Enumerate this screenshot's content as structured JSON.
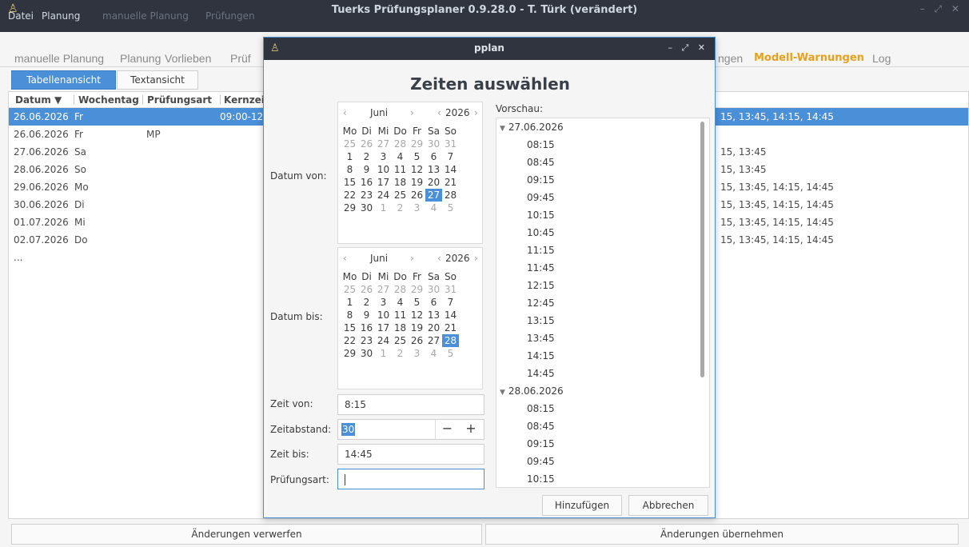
{
  "window": {
    "title": "Tuerks Prüfungsplaner 0.9.28.0 - T. Türk (verändert)",
    "controls": "– ⤢ ✕"
  },
  "menubar": {
    "items": [
      "Datei",
      "Planung",
      "manuelle Planung",
      "Prüfungen"
    ]
  },
  "navtabs": {
    "items": [
      "manuelle Planung",
      "Planung",
      "Vorlieben",
      "Prüf"
    ],
    "right_partial": "ngen",
    "warnings": "Modell-Warnungen",
    "log": "Log"
  },
  "viewtabs": {
    "table": "Tabellenansicht",
    "text": "Textansicht"
  },
  "table": {
    "headers": {
      "datum": "Datum ▼",
      "wochentag": "Wochentag",
      "pruefungsart": "Prüfungsart",
      "kernzeit": "Kernzei"
    },
    "rows": [
      {
        "datum": "26.06.2026",
        "tag": "Fr",
        "art": "",
        "kern": "09:00-12",
        "times": "15, 13:45, 14:15, 14:45"
      },
      {
        "datum": "26.06.2026",
        "tag": "Fr",
        "art": "MP",
        "kern": "",
        "times": ""
      },
      {
        "datum": "27.06.2026",
        "tag": "Sa",
        "art": "",
        "kern": "",
        "times": "15, 13:45"
      },
      {
        "datum": "28.06.2026",
        "tag": "So",
        "art": "",
        "kern": "",
        "times": "15, 13:45"
      },
      {
        "datum": "29.06.2026",
        "tag": "Mo",
        "art": "",
        "kern": "",
        "times": "15, 13:45, 14:15, 14:45"
      },
      {
        "datum": "30.06.2026",
        "tag": "Di",
        "art": "",
        "kern": "",
        "times": "15, 13:45, 14:15, 14:45"
      },
      {
        "datum": "01.07.2026",
        "tag": "Mi",
        "art": "",
        "kern": "",
        "times": "15, 13:45, 14:15, 14:45"
      },
      {
        "datum": "02.07.2026",
        "tag": "Do",
        "art": "",
        "kern": "",
        "times": "15, 13:45, 14:15, 14:45"
      }
    ],
    "ellipsis": "..."
  },
  "bottom": {
    "discard": "Änderungen verwerfen",
    "apply": "Änderungen übernehmen"
  },
  "dialog": {
    "title": "pplan",
    "controls": "– ⤢ ✕",
    "heading": "Zeiten auswählen",
    "labels": {
      "datum_von": "Datum von:",
      "datum_bis": "Datum bis:",
      "zeit_von": "Zeit von:",
      "zeitabstand": "Zeitabstand:",
      "zeit_bis": "Zeit bis:",
      "pruefungsart": "Prüfungsart:",
      "vorschau": "Vorschau:"
    },
    "calendar": {
      "month": "Juni",
      "year": "2026",
      "weekdays": [
        "Mo",
        "Di",
        "Mi",
        "Do",
        "Fr",
        "Sa",
        "So"
      ],
      "weeks": [
        [
          "25",
          "26",
          "27",
          "28",
          "29",
          "30",
          "31"
        ],
        [
          "1",
          "2",
          "3",
          "4",
          "5",
          "6",
          "7"
        ],
        [
          "8",
          "9",
          "10",
          "11",
          "12",
          "13",
          "14"
        ],
        [
          "15",
          "16",
          "17",
          "18",
          "19",
          "20",
          "21"
        ],
        [
          "22",
          "23",
          "24",
          "25",
          "26",
          "27",
          "28"
        ],
        [
          "29",
          "30",
          "1",
          "2",
          "3",
          "4",
          "5"
        ]
      ],
      "from_selected": "27",
      "to_selected": "28"
    },
    "fields": {
      "zeit_von": "8:15",
      "zeitabstand": "30",
      "zeit_bis": "14:45",
      "pruefungsart": ""
    },
    "preview": {
      "groups": [
        {
          "date": "27.06.2026",
          "times": [
            "08:15",
            "08:45",
            "09:15",
            "09:45",
            "10:15",
            "10:45",
            "11:15",
            "11:45",
            "12:15",
            "12:45",
            "13:15",
            "13:45",
            "14:15",
            "14:45"
          ]
        },
        {
          "date": "28.06.2026",
          "times": [
            "08:15",
            "08:45",
            "09:15",
            "09:45",
            "10:15"
          ]
        }
      ]
    },
    "buttons": {
      "add": "Hinzufügen",
      "cancel": "Abbrechen"
    }
  }
}
